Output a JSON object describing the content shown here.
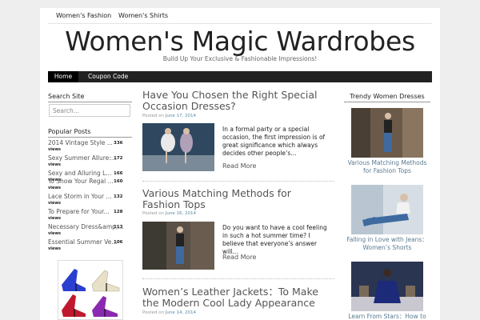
{
  "top_nav": [
    "Women's Fashion",
    "Women's Shirts"
  ],
  "site": {
    "title": "Women's Magic Wardrobes",
    "tagline": "Build Up Your Exclusive & Fashionable Impressions!"
  },
  "main_nav": {
    "home": "Home",
    "coupon": "Coupon Code"
  },
  "sidebar_left": {
    "search_title": "Search Site",
    "search_placeholder": "Search...",
    "popular_title": "Popular Posts",
    "popular": [
      {
        "title": "2014 Vintage Style ...",
        "count": "336"
      },
      {
        "title": "Sexy Summer Allure:...",
        "count": "172"
      },
      {
        "title": "Sexy and Alluring L...",
        "count": "166"
      },
      {
        "title": "To Show Your Regal ...",
        "count": "160"
      },
      {
        "title": "Lace Storm in Your ...",
        "count": "132"
      },
      {
        "title": "To Prepare for Your...",
        "count": "128"
      },
      {
        "title": "Necessary Dress&amp;...",
        "count": "113"
      },
      {
        "title": "Essential Summer Ve...",
        "count": "106"
      }
    ],
    "views_label": "views"
  },
  "posts": [
    {
      "title": "Have You Chosen the Right Special Occasion Dresses?",
      "posted_label": "Posted on",
      "date": "June 17, 2014",
      "excerpt": "In a formal party or a special occasion, the first impression is of great significance which always decides other people’s...",
      "read_more": "Read More"
    },
    {
      "title": "Various Matching Methods for Fashion Tops",
      "posted_label": "Posted on",
      "date": "June 16, 2014",
      "excerpt": "Do you want to have a cool feeling in such a hot summer time? I believe that everyone’s answer will...",
      "read_more": "Read More"
    },
    {
      "title": "Women’s Leather Jackets：To Make the Modern Cool Lady Appearance",
      "posted_label": "Posted on",
      "date": "June 14, 2014"
    }
  ],
  "sidebar_right": {
    "title": "Trendy Women Dresses",
    "items": [
      {
        "caption": "Various Matching Methods for Fashion Tops"
      },
      {
        "caption": "Falling in Love with Jeans：Women’s Shorts"
      },
      {
        "caption": "Learn From Stars：How to"
      }
    ]
  }
}
